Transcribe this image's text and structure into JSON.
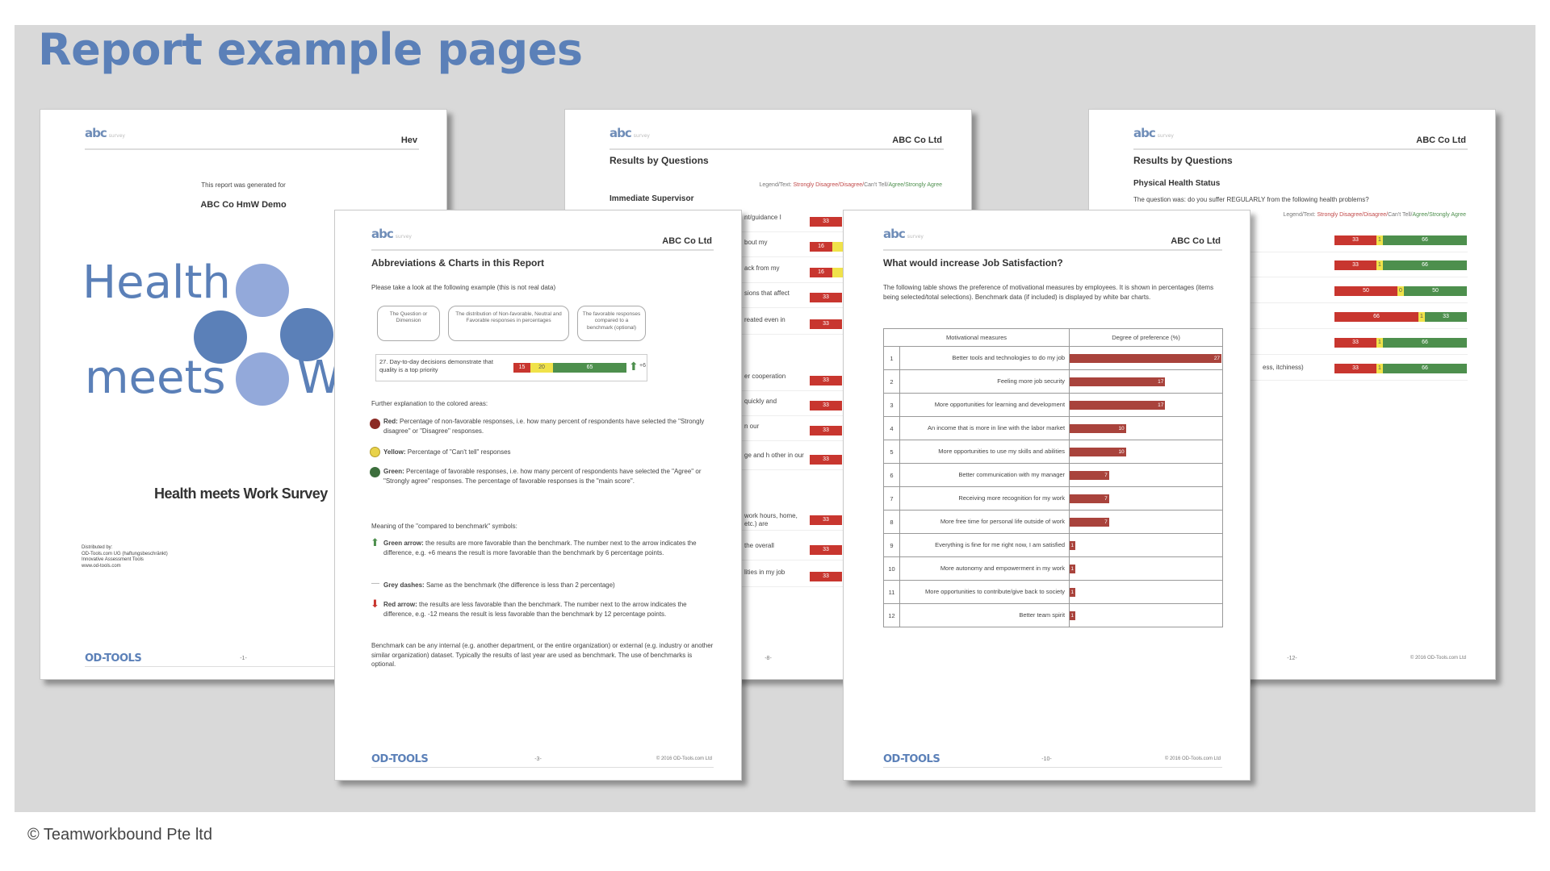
{
  "title": "Report example pages",
  "footer": "© Teamworkbound Pte ltd",
  "colors": {
    "title": "#5b80b8",
    "red": "#c8362f",
    "yellow": "#f0e24a",
    "green": "#4d8f4d",
    "job_bar": "#a9433c",
    "panel": "#d9d9d9"
  },
  "common": {
    "logo": "abc",
    "company": "ABC Co Ltd",
    "od_tools": "OD-TOOLS",
    "copyright": "© 2016 OD-Tools.com Ltd",
    "legend": {
      "prefix": "Legend/Text: ",
      "red": "Strongly Disagree/Disagree/",
      "neutral": "Can't Tell/",
      "green": "Agree/Strongly Agree"
    }
  },
  "cover": {
    "header_right": "Hev",
    "generated_for": "This report was generated for",
    "client": "ABC Co HmW Demo",
    "logo_word1": "Health",
    "logo_word2": "meets",
    "logo_word3": "W",
    "survey_title": "Health meets Work Survey",
    "distributed": [
      "Distributed by:",
      "OD-Tools.com UG (haftungsbeschränkt)",
      "Innovative Assessment Tools",
      "www.od-tools.com"
    ],
    "page": "-1-"
  },
  "supervisor": {
    "title": "Results by Questions",
    "section": "Immediate Supervisor",
    "page": "-8-",
    "rows": [
      {
        "text": "nt/guidance I",
        "red": 33
      },
      {
        "text": "bout my",
        "red": 16,
        "yellow": true
      },
      {
        "text": "ack from my",
        "red": 16,
        "yellow": true
      },
      {
        "text": "sions that affect",
        "red": 33
      },
      {
        "text": "reated even in",
        "red": 33
      },
      {
        "text": "er cooperation",
        "red": 33
      },
      {
        "text": "quickly and",
        "red": 33
      },
      {
        "text": "n our",
        "red": 33
      },
      {
        "text": "ge and h other in our",
        "red": 33
      },
      {
        "text": "work hours, home, etc.) are",
        "red": 33
      },
      {
        "text": "the overall",
        "red": 33
      },
      {
        "text": "lities in my job",
        "red": 33
      }
    ]
  },
  "health": {
    "title": "Results by Questions",
    "section": "Physical Health Status",
    "question": "The question was: do you suffer REGULARLY from the following health problems?",
    "page": "-12-",
    "rows": [
      {
        "text": "",
        "red": 33,
        "neutral": 1,
        "green": 66
      },
      {
        "text": "",
        "red": 33,
        "neutral": 1,
        "green": 66
      },
      {
        "text": "",
        "red": 50,
        "neutral": 0,
        "green": 50
      },
      {
        "text": "",
        "red": 66,
        "neutral": 1,
        "green": 33
      },
      {
        "text": "",
        "red": 33,
        "neutral": 1,
        "green": 66
      },
      {
        "text": "ess, itchiness)",
        "red": 33,
        "neutral": 1,
        "green": 66
      }
    ]
  },
  "abbrev": {
    "title": "Abbreviations & Charts in this Report",
    "intro": "Please take a look at the following example (this is not real data)",
    "callouts": [
      "The Question or Dimension",
      "The distribution of Non-favorable, Neutral and Favorable responses in percentages",
      "The favorable responses compared to a benchmark (optional)"
    ],
    "example": {
      "question": "27. Day-to-day decisions demonstrate that quality is a top priority",
      "red": 15,
      "yellow": 20,
      "green": 65,
      "delta": "+6"
    },
    "explain_heading": "Further explanation to the colored areas:",
    "red_label": "Red:",
    "red_text": "Percentage of non-favorable responses, i.e. how many percent of respondents have selected the \"Strongly disagree\" or \"Disagree\" responses.",
    "yellow_label": "Yellow:",
    "yellow_text": "Percentage of \"Can't tell\" responses",
    "green_label": "Green:",
    "green_text": "Percentage of favorable responses, i.e. how many percent of respondents have selected the \"Agree\" or \"Strongly agree\" responses. The percentage of favorable responses is the \"main score\".",
    "symbols_heading": "Meaning of the \"compared to benchmark\" symbols:",
    "up_label": "Green arrow:",
    "up_text": "the results are more favorable than the benchmark. The number next to the arrow indicates the difference, e.g. +6 means the result is more favorable than the benchmark by 6 percentage points.",
    "dash_label": "Grey dashes:",
    "dash_text": "Same as the benchmark (the difference is less than 2 percentage)",
    "down_label": "Red arrow:",
    "down_text": "the results are less favorable than the benchmark. The number next to the arrow indicates the difference, e.g. -12 means the result is less favorable than the benchmark by 12 percentage points.",
    "benchmark_text": "Benchmark can be any internal (e.g. another department, or the entire organization) or external (e.g. industry or another similar organization) dataset. Typically the results of last year are used as benchmark. The use of benchmarks is optional.",
    "page": "-3-"
  },
  "jobsat": {
    "title": "What would increase Job Satisfaction?",
    "intro": "The following table shows the preference of motivational measures by employees. It is shown in percentages (items being selected/total selections). Benchmark data (if included) is displayed by white bar charts.",
    "col1": "Motivational measures",
    "col2": "Degree of preference (%)",
    "page": "-10-",
    "rows": [
      {
        "n": "1",
        "label": "Better tools and technologies to do my job",
        "value": 27
      },
      {
        "n": "2",
        "label": "Feeling more job security",
        "value": 17
      },
      {
        "n": "3",
        "label": "More opportunities for learning and development",
        "value": 17
      },
      {
        "n": "4",
        "label": "An income that is more in line with the labor market",
        "value": 10
      },
      {
        "n": "5",
        "label": "More opportunities to use my skills and abilities",
        "value": 10
      },
      {
        "n": "6",
        "label": "Better communication with my manager",
        "value": 7
      },
      {
        "n": "7",
        "label": "Receiving more recognition for my work",
        "value": 7
      },
      {
        "n": "8",
        "label": "More free time for personal life outside of work",
        "value": 7
      },
      {
        "n": "9",
        "label": "Everything is fine for me right now, I am satisfied",
        "value": 1
      },
      {
        "n": "10",
        "label": "More autonomy and empowerment in my work",
        "value": 1
      },
      {
        "n": "11",
        "label": "More opportunities to contribute/give back to society",
        "value": 1
      },
      {
        "n": "12",
        "label": "Better team spirit",
        "value": 1
      }
    ]
  }
}
